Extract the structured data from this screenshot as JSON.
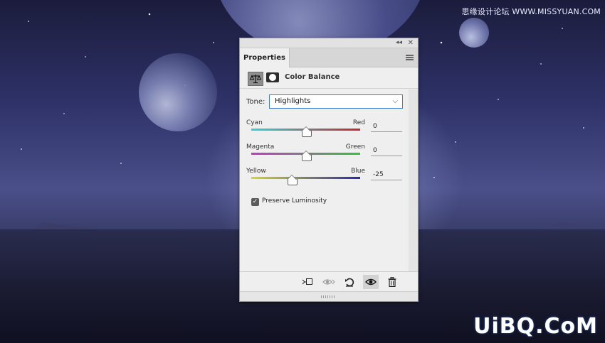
{
  "watermarks": {
    "top": "思缘设计论坛 WWW.MISSYUAN.COM",
    "bottom": "UiBQ.CoM"
  },
  "panel": {
    "tab_label": "Properties",
    "adjustment_title": "Color Balance",
    "tone": {
      "label": "Tone:",
      "selected": "Highlights"
    },
    "sliders": [
      {
        "left_label": "Cyan",
        "right_label": "Red",
        "value": "0",
        "colors": [
          "#2fd3d6",
          "#c9262a"
        ],
        "range": [
          -100,
          100
        ]
      },
      {
        "left_label": "Magenta",
        "right_label": "Green",
        "value": "0",
        "colors": [
          "#c934c9",
          "#33c43a"
        ],
        "range": [
          -100,
          100
        ]
      },
      {
        "left_label": "Yellow",
        "right_label": "Blue",
        "value": "-25",
        "colors": [
          "#d6d62a",
          "#2a2aa8"
        ],
        "range": [
          -100,
          100
        ]
      }
    ],
    "preserve_luminosity": {
      "label": "Preserve Luminosity",
      "checked": true
    },
    "footer_icons": [
      "clip-to-layer-icon",
      "view-previous-icon",
      "reset-icon",
      "visibility-icon",
      "trash-icon"
    ]
  }
}
